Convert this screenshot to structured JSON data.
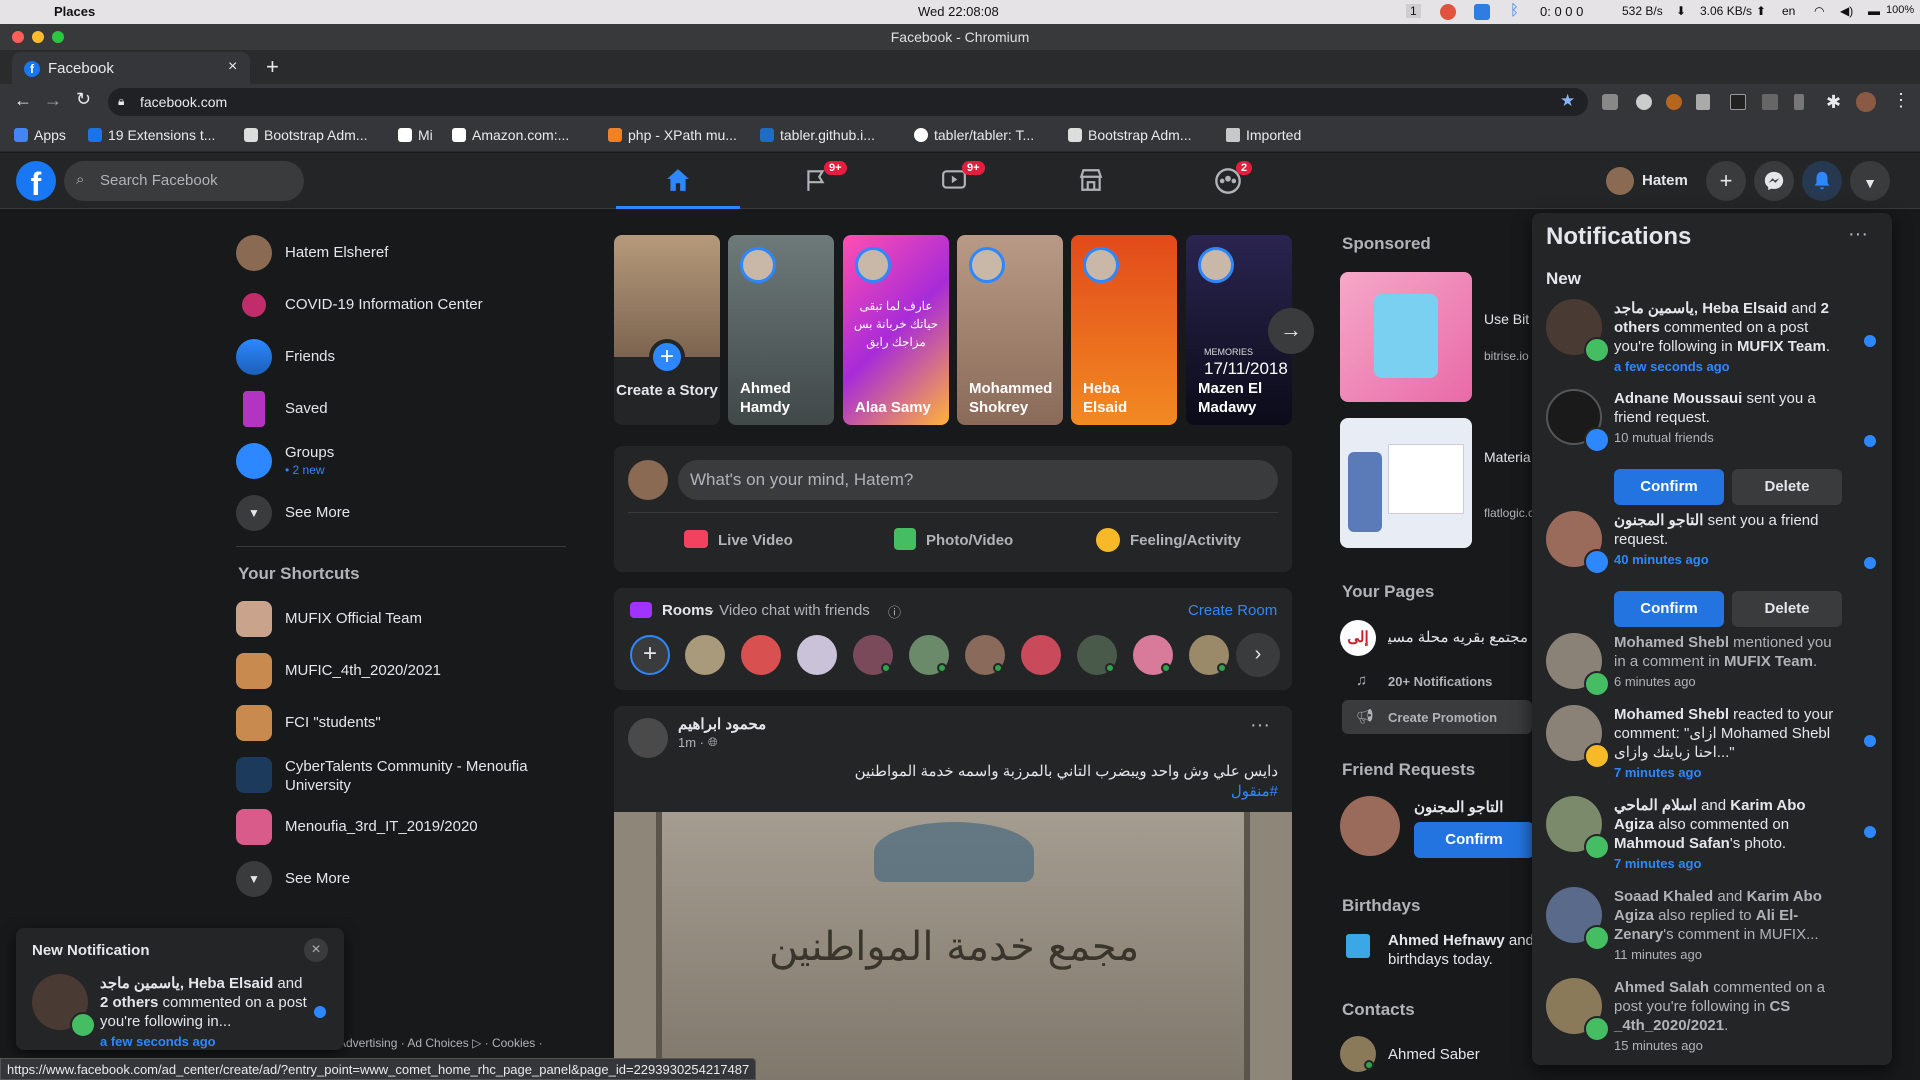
{
  "macbar": {
    "app": "Places",
    "clock": "Wed 22:08:08",
    "desktop": "1",
    "timer": "0: 0 0 0",
    "net_down": "532 B/s",
    "net_up": "3.06 KB/s",
    "lang": "en",
    "battery": "100%"
  },
  "window": {
    "title": "Facebook - Chromium"
  },
  "tab": {
    "title": "Facebook"
  },
  "address": {
    "url": "facebook.com"
  },
  "bookmarks": [
    "Apps",
    "19 Extensions t...",
    "Bootstrap Adm...",
    "Mi",
    "Amazon.com:...",
    "php - XPath mu...",
    "tabler.github.i...",
    "tabler/tabler: T...",
    "Bootstrap Adm...",
    "Imported"
  ],
  "header": {
    "search_placeholder": "Search Facebook",
    "user_name": "Hatem",
    "badges": {
      "pages": "9+",
      "watch": "9+",
      "groups": "2"
    }
  },
  "left_nav": {
    "items": [
      {
        "label": "Hatem Elsheref"
      },
      {
        "label": "COVID-19 Information Center"
      },
      {
        "label": "Friends"
      },
      {
        "label": "Saved"
      },
      {
        "label": "Groups",
        "sub": "• 2 new"
      },
      {
        "label": "See More"
      }
    ],
    "shortcuts_title": "Your Shortcuts",
    "shortcuts": [
      {
        "label": "MUFIX Official Team"
      },
      {
        "label": "MUFIC_4th_2020/2021"
      },
      {
        "label": "FCI \"students\""
      },
      {
        "label": "CyberTalents Community - Menoufia University"
      },
      {
        "label": "Menoufia_3rd_IT_2019/2020"
      },
      {
        "label": "See More"
      }
    ],
    "footer": "Advertising · Ad Choices ▷ · Cookies ·"
  },
  "stories": [
    {
      "label": "Create a Story"
    },
    {
      "label": "Ahmed Hamdy"
    },
    {
      "label": "Alaa Samy"
    },
    {
      "label": "Mohammed Shokrey"
    },
    {
      "label": "Heba Elsaid"
    },
    {
      "label": "Mazen El Madawy"
    }
  ],
  "story_overlay": {
    "alaa_text": "عارف لما تبقى حياتك خربانة بس مزاجك رايق",
    "mazen_line1": "MEMORIES",
    "mazen_line2": "17/11/2018"
  },
  "composer": {
    "placeholder": "What's on your mind, Hatem?",
    "live": "Live Video",
    "photo": "Photo/Video",
    "feeling": "Feeling/Activity"
  },
  "rooms": {
    "title": "Rooms",
    "subtitle": "· Video chat with friends",
    "create": "Create Room"
  },
  "post": {
    "author": "محمود ابراهيم",
    "time": "1m ·",
    "text": "دايس علي وش واحد ويبضرب التاني بالمرزبة واسمه خدمة المواطنين",
    "hashtag": "#منقول",
    "sign": "مجمع خدمة المواطنين"
  },
  "right": {
    "sponsored": "Sponsored",
    "ads": [
      {
        "title": "Use Bit iOS ap",
        "url": "bitrise.io"
      },
      {
        "title": "Materia and Ad Theme",
        "url": "flatlogic.c"
      }
    ],
    "your_pages": "Your Pages",
    "page_name": "مجتمع بقريه محلة مسير",
    "page_logo": "إلى",
    "page_notifs": "20+ Notifications",
    "create_promo": "Create Promotion",
    "friend_requests": "Friend Requests",
    "fr_name": "التاجو المجنون",
    "fr_confirm": "Confirm",
    "birthdays": "Birthdays",
    "bday_name": "Ahmed Hefnawy",
    "bday_rest": " and",
    "bday_line2": "birthdays today.",
    "contacts": "Contacts",
    "contact1": "Ahmed Saber"
  },
  "notifications": {
    "title": "Notifications",
    "section": "New",
    "confirm": "Confirm",
    "delete": "Delete",
    "items": [
      {
        "name": "ياسمين ماجد, Heba Elsaid",
        "mid": " and ",
        "bold2": "2 others",
        "text": " commented on a post you're following in ",
        "bold3": "MUFIX Team",
        "end": ".",
        "time": "a few seconds ago",
        "unread": true
      },
      {
        "name": "Adnane Moussaui",
        "text": " sent you a friend request.",
        "sub": "10 mutual friends",
        "unread": true
      },
      {
        "name": "التاجو المجنون",
        "text": " sent you a friend request.",
        "time": "40 minutes ago",
        "unread": true
      },
      {
        "name": "Mohamed Shebl",
        "text": " mentioned you in a comment in ",
        "bold3": "MUFIX Team",
        "end": ".",
        "time": "6 minutes ago",
        "unread": false
      },
      {
        "name": "Mohamed Shebl",
        "text": " reacted to your comment: \"ازاى Mohamed Shebl احنا زبايتك وازاى...\"",
        "time": "7 minutes ago",
        "unread": true
      },
      {
        "name": "اسلام الماحي",
        "mid": " and ",
        "bold2": "Karim Abo Agiza",
        "text": " also commented on ",
        "bold3": "Mahmoud Safan",
        "end": "'s photo.",
        "time": "7 minutes ago",
        "unread": true
      },
      {
        "name": "Soaad Khaled",
        "mid": " and ",
        "bold2": "Karim Abo Agiza",
        "text": " also replied to ",
        "bold3": "Ali El-Zenary",
        "end": "'s comment in MUFIX...",
        "time": "11 minutes ago",
        "unread": false
      },
      {
        "name": "Ahmed Salah",
        "text": " commented on a post you're following in ",
        "bold3": "CS _4th_2020/2021",
        "end": ".",
        "time": "15 minutes ago",
        "unread": false
      }
    ]
  },
  "popup": {
    "title": "New Notification",
    "name": "ياسمين ماجد, Heba Elsaid",
    "rest": " and ",
    "bold2": "2 others",
    "text": " commented on a post you're following in...",
    "time": "a few seconds ago"
  },
  "statusbar": {
    "url": "https://www.facebook.com/ad_center/create/ad/?entry_point=www_comet_home_rhc_page_panel&page_id=2293930254217487"
  },
  "colors": {
    "fb_blue": "#1877f2",
    "accent": "#2d88ff",
    "badge": "#e41e3f",
    "bg": "#18191a",
    "card": "#242526"
  }
}
